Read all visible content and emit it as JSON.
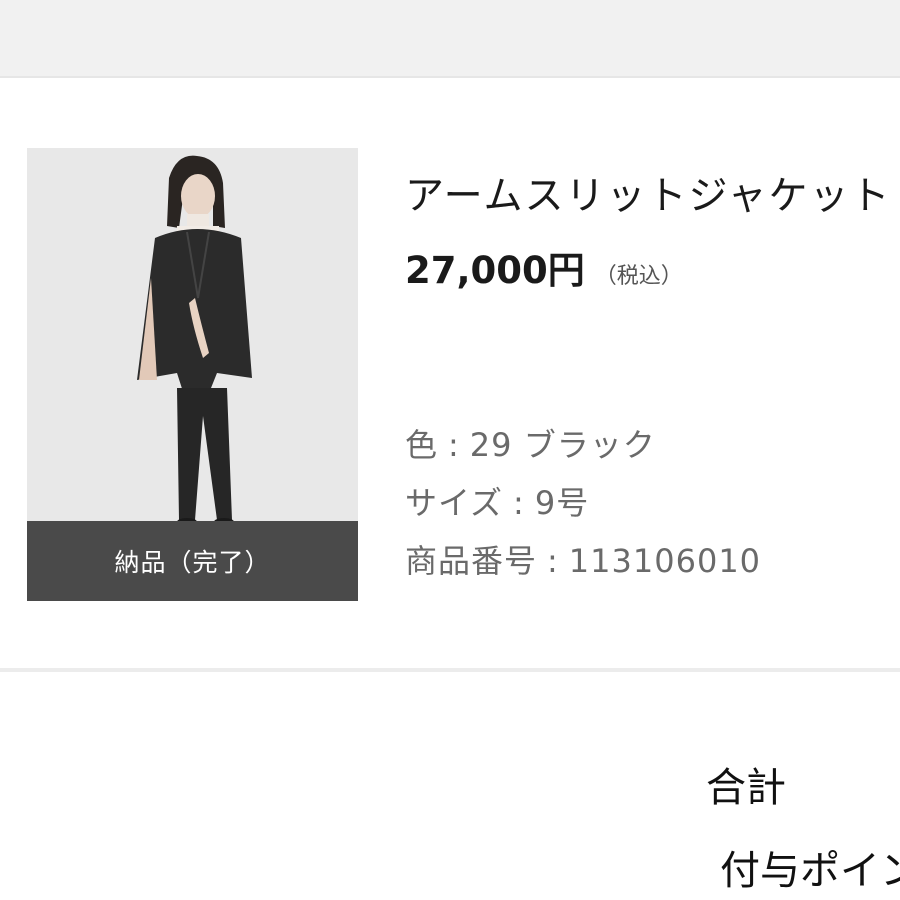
{
  "order_item": {
    "status_label": "納品（完了）",
    "product_name": "アームスリットジャケット",
    "price": "27,000円",
    "tax_note": "（税込）",
    "color_label": "色",
    "color_value": "29 ブラック",
    "size_label": "サイズ",
    "size_value": "9号",
    "product_number_label": "商品番号",
    "product_number_value": "113106010",
    "separator": ":"
  },
  "summary": {
    "total_label": "合計",
    "points_label": "付与ポイント"
  }
}
